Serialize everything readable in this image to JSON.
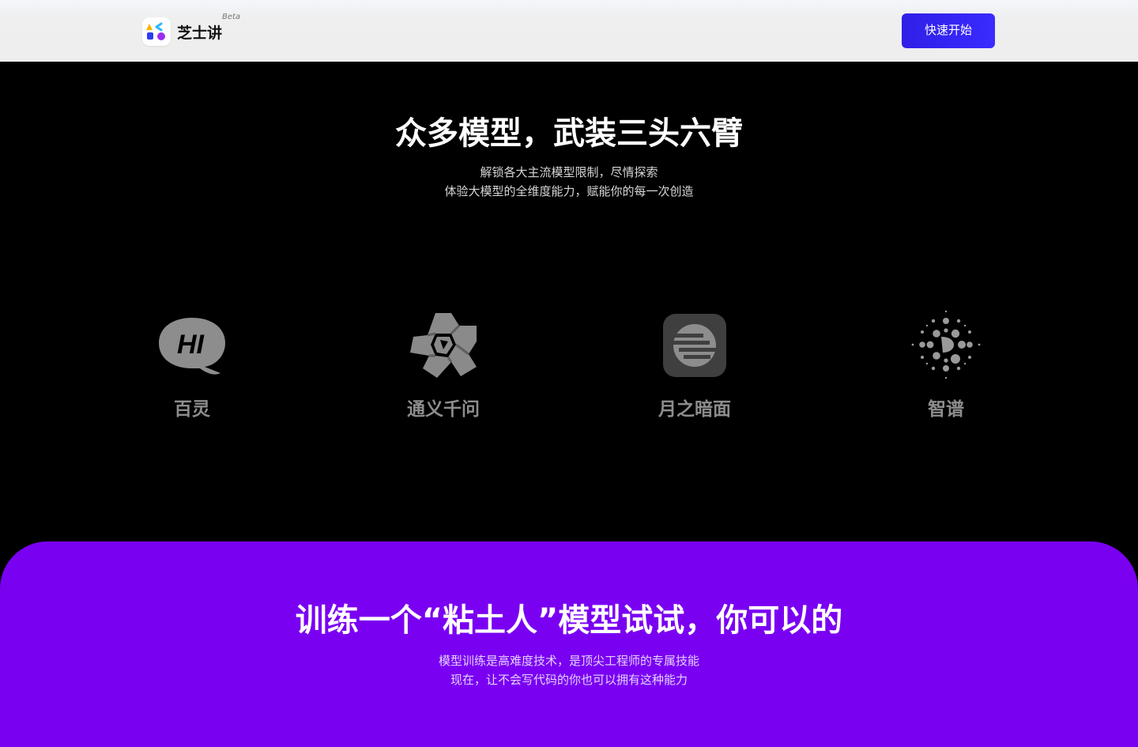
{
  "header": {
    "brand": "芝士讲",
    "badge": "Beta",
    "cta_label": "快速开始"
  },
  "models_section": {
    "title": "众多模型，武装三头六臂",
    "subtitle_line1": "解锁各大主流模型限制，尽情探索",
    "subtitle_line2": "体验大模型的全维度能力，赋能你的每一次创造",
    "models": [
      {
        "name": "百灵",
        "icon": "bailing-hi-bubble-icon",
        "icon_text": "HI"
      },
      {
        "name": "通义千问",
        "icon": "tongyi-qianwen-icon"
      },
      {
        "name": "月之暗面",
        "icon": "moonshot-icon"
      },
      {
        "name": "智谱",
        "icon": "zhipu-dots-icon"
      }
    ]
  },
  "training_section": {
    "title": "训练一个“粘土人”模型试试，你可以的",
    "subtitle_line1": "模型训练是高难度技术，是顶尖工程师的专属技能",
    "subtitle_line2": "现在，让不会写代码的你也可以拥有这种能力"
  },
  "colors": {
    "cta": "#3a2bff",
    "purple_band": "#7a00f2",
    "model_icon_gray": "#8d8d8d"
  }
}
